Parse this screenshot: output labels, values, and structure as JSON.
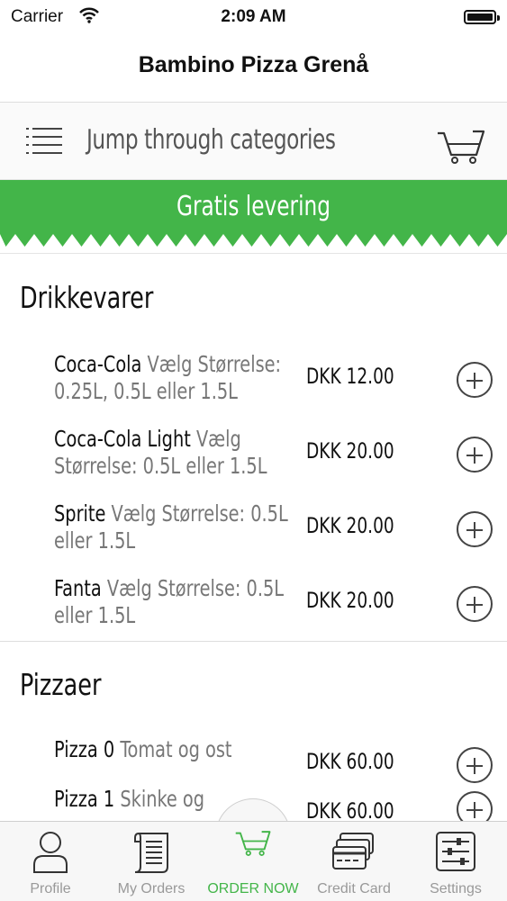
{
  "status_bar": {
    "carrier": "Carrier",
    "time": "2:09 AM"
  },
  "nav": {
    "title": "Bambino Pizza Grenå"
  },
  "category_bar": {
    "text": "Jump through categories",
    "menu_icon": "hamburger-list-icon",
    "cart_icon": "cart-icon"
  },
  "promo": {
    "text": "Gratis levering",
    "color": "#43b549"
  },
  "sections": [
    {
      "title": "Drikkevarer",
      "items": [
        {
          "name": "Coca-Cola",
          "desc": "Vælg Størrelse: 0.25L, 0.5L eller 1.5L",
          "price": "DKK 12.00"
        },
        {
          "name": "Coca-Cola Light",
          "desc": "Vælg Størrelse: 0.5L eller 1.5L",
          "price": "DKK 20.00"
        },
        {
          "name": "Sprite",
          "desc": "Vælg Størrelse: 0.5L eller 1.5L",
          "price": "DKK 20.00"
        },
        {
          "name": "Fanta",
          "desc": "Vælg Størrelse: 0.5L eller 1.5L",
          "price": "DKK 20.00"
        }
      ]
    },
    {
      "title": "Pizzaer",
      "items": [
        {
          "name": "Pizza 0",
          "desc": "Tomat og ost",
          "price": "DKK 60.00"
        },
        {
          "name": "Pizza 1",
          "desc": "Skinke og",
          "price": "DKK 60.00"
        }
      ]
    }
  ],
  "tab_bar": {
    "active_color": "#43b549",
    "tabs": [
      {
        "label": "Profile",
        "icon": "person-icon"
      },
      {
        "label": "My Orders",
        "icon": "receipt-icon"
      },
      {
        "label": "ORDER NOW",
        "icon": "cart-icon",
        "active": true
      },
      {
        "label": "Credit Card",
        "icon": "credit-cards-icon"
      },
      {
        "label": "Settings",
        "icon": "sliders-icon"
      }
    ]
  }
}
